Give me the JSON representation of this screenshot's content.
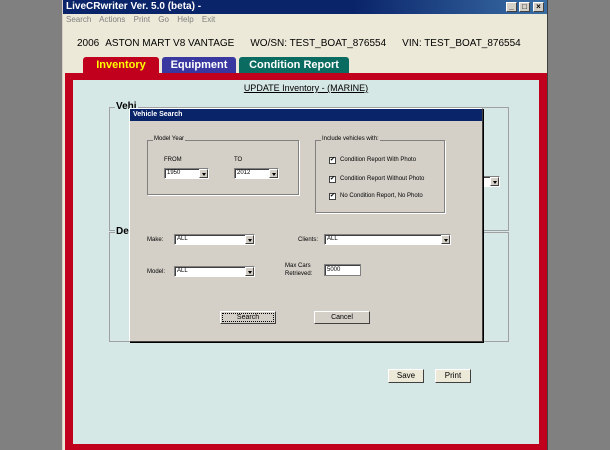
{
  "window": {
    "title": "LiveCRwriter Ver. 5.0 (beta) -"
  },
  "menu": [
    "Search",
    "Actions",
    "Print",
    "Go",
    "Help",
    "Exit"
  ],
  "vehicle_info": {
    "year": "2006",
    "name": "ASTON MART V8 VANTAGE",
    "wo": "WO/SN: TEST_BOAT_876554",
    "vin": "VIN: TEST_BOAT_876554"
  },
  "tabs": [
    {
      "label": "Inventory",
      "color": "#c0001c",
      "text_color": "#ffff00"
    },
    {
      "label": "Equipment",
      "color": "#3838a0",
      "text_color": "#ffffff"
    },
    {
      "label": "Condition Report",
      "color": "#0a6b60",
      "text_color": "#ffffff"
    }
  ],
  "main": {
    "update_title": "UPDATE Inventory - (MARINE)",
    "group1_label": "Vehi",
    "group2_label": "De",
    "save_label": "Save",
    "print_label": "Print"
  },
  "dialog": {
    "title": "Vehicle Search",
    "model_year_legend": "Model Year",
    "from_label": "FROM",
    "to_label": "TO",
    "from_value": "1950",
    "to_value": "2012",
    "include_legend": "Include vehicles with:",
    "checks": [
      {
        "label": "Condition Report With Photo",
        "checked": true
      },
      {
        "label": "Condition Report Without Photo",
        "checked": true
      },
      {
        "label": "No Condition Report, No Photo",
        "checked": true
      }
    ],
    "make_label": "Make:",
    "make_value": "ALL",
    "clients_label": "Clients:",
    "clients_value": "ALL",
    "model_label": "Model:",
    "model_value": "ALL",
    "maxcars_label1": "Max Cars",
    "maxcars_label2": "Retrieved:",
    "maxcars_value": "5000",
    "search_label": "Search",
    "cancel_label": "Cancel"
  }
}
